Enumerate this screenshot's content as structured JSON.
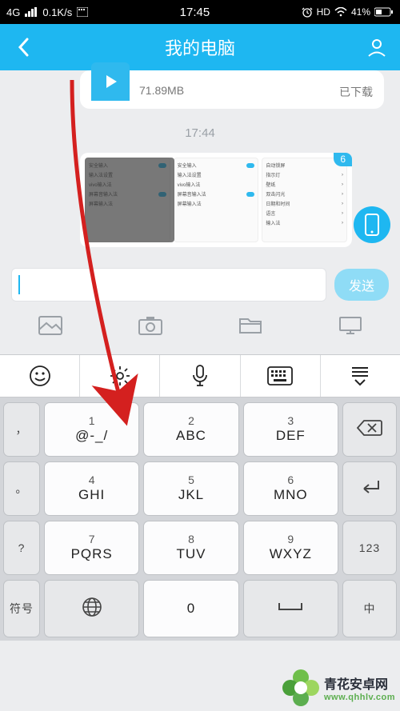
{
  "status_bar": {
    "network": "4G",
    "speed": "0.1K/s",
    "time": "17:45",
    "hd": "HD",
    "battery_pct": "41%"
  },
  "header": {
    "title": "我的电脑"
  },
  "chat": {
    "file_size": "71.89MB",
    "file_status": "已下载",
    "time_sep": "17:44",
    "image_badge": "6"
  },
  "input_row": {
    "placeholder": "",
    "send_label": "发送"
  },
  "keyboard": {
    "punct1": "，",
    "punct2": "。",
    "k1": {
      "num": "1",
      "lbl": "@-_/"
    },
    "k2": {
      "num": "2",
      "lbl": "ABC"
    },
    "k3": {
      "num": "3",
      "lbl": "DEF"
    },
    "k4": {
      "num": "4",
      "lbl": "GHI"
    },
    "k5": {
      "num": "5",
      "lbl": "JKL"
    },
    "k6": {
      "num": "6",
      "lbl": "MNO"
    },
    "k7": {
      "num": "7",
      "lbl": "PQRS"
    },
    "k8": {
      "num": "8",
      "lbl": "TUV"
    },
    "k9": {
      "num": "9",
      "lbl": "WXYZ"
    },
    "k0": {
      "num": "",
      "lbl": "0"
    },
    "sym_label": "符号",
    "num_label": "123",
    "cn_label": "中"
  },
  "watermark": {
    "title": "青花安卓网",
    "url": "www.qhhlv.com"
  }
}
